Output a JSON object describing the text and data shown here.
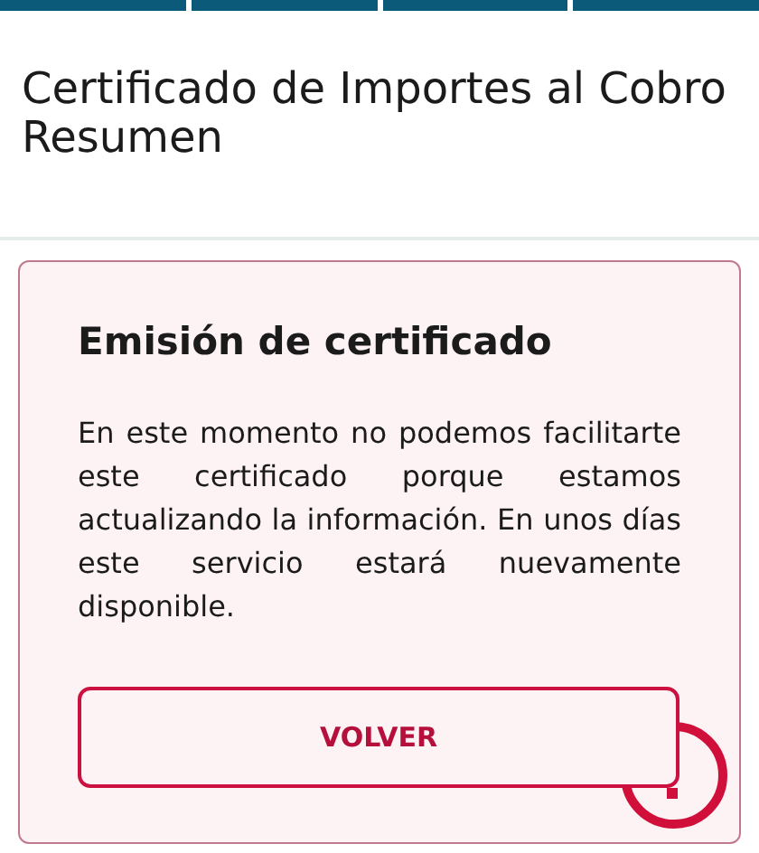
{
  "progress": {
    "steps": [
      {
        "completed": true
      },
      {
        "completed": true
      },
      {
        "completed": true
      },
      {
        "completed": true
      }
    ]
  },
  "title": "Certificado de Importes al Cobro Resumen",
  "card": {
    "heading": "Emisión de certificado",
    "message": "En este momento no podemos facilitarte este certificado porque estamos actualizando la información. En unos días este servicio estará nuevamente disponible.",
    "button": "VOLVER"
  }
}
